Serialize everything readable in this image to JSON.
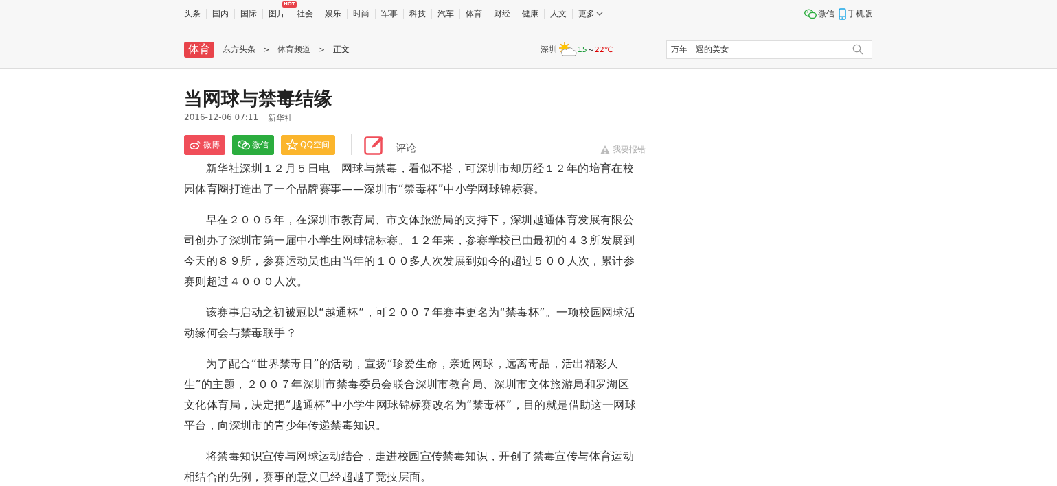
{
  "nav": {
    "items": [
      {
        "label": "头条"
      },
      {
        "label": "国内"
      },
      {
        "label": "国际"
      },
      {
        "label": "图片",
        "badge": "HOT"
      },
      {
        "label": "社会"
      },
      {
        "label": "娱乐"
      },
      {
        "label": "时尚"
      },
      {
        "label": "军事"
      },
      {
        "label": "科技"
      },
      {
        "label": "汽车"
      },
      {
        "label": "体育"
      },
      {
        "label": "财经"
      },
      {
        "label": "健康"
      },
      {
        "label": "人文"
      },
      {
        "label": "更多",
        "dropdown": true
      }
    ],
    "links": [
      {
        "label": "微信",
        "kind": "wechat"
      },
      {
        "label": "手机版",
        "kind": "mobile"
      }
    ]
  },
  "channel": {
    "tag": "体育",
    "breadcrumb": [
      {
        "label": "东方头条"
      },
      {
        "label": "体育频道"
      },
      {
        "label": "正文"
      }
    ],
    "separator": ">"
  },
  "weather": {
    "city": "深圳",
    "low": "15",
    "range_sep": "～",
    "high": "22℃"
  },
  "search": {
    "value": "万年一遇的美女"
  },
  "article": {
    "title": "当网球与禁毒结缘",
    "date": "2016-12-06 07:11",
    "source": "新华社",
    "share": [
      {
        "label": "微博",
        "kind": "weibo",
        "color": "#f04e59"
      },
      {
        "label": "微信",
        "kind": "wechat",
        "color": "#2bad3e"
      },
      {
        "label": "QQ空间",
        "kind": "qzone",
        "color": "#fbb52c"
      }
    ],
    "comment": "评论",
    "report": "我要报错",
    "paragraphs": [
      "新华社深圳１２月５日电　网球与禁毒，看似不搭，可深圳市却历经１２年的培育在校园体育圈打造出了一个品牌赛事——深圳市“禁毒杯”中小学网球锦标赛。",
      "早在２００５年，在深圳市教育局、市文体旅游局的支持下，深圳越通体育发展有限公司创办了深圳市第一届中小学生网球锦标赛。１２年来，参赛学校已由最初的４３所发展到今天的８９所，参赛运动员也由当年的１００多人次发展到如今的超过５００人次，累计参赛则超过４０００人次。",
      "该赛事启动之初被冠以“越通杯”，可２００７年赛事更名为“禁毒杯”。一项校园网球活动缘何会与禁毒联手？",
      "为了配合“世界禁毒日”的活动，宣扬“珍爱生命，亲近网球，远离毒品，活出精彩人生”的主题，２００７年深圳市禁毒委员会联合深圳市教育局、深圳市文体旅游局和罗湖区文化体育局，决定把“越通杯”中小学生网球锦标赛改名为“禁毒杯”，目的就是借助这一网球平台，向深圳市的青少年传递禁毒知识。",
      "将禁毒知识宣传与网球运动结合，走进校园宣传禁毒知识，开创了禁毒宣传与体育运动相结合的先例，赛事的意义已经超越了竞技层面。"
    ]
  }
}
